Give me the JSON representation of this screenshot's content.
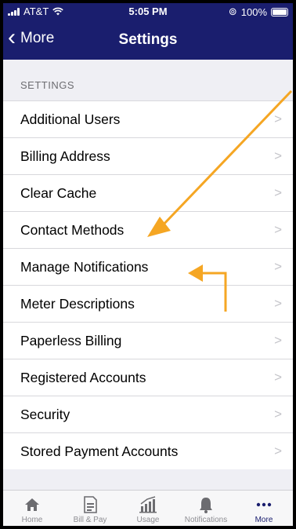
{
  "status_bar": {
    "carrier": "AT&T",
    "time": "5:05 PM",
    "battery": "100%"
  },
  "nav": {
    "back_label": "More",
    "title": "Settings"
  },
  "section": {
    "title": "SETTINGS"
  },
  "settings_items": [
    {
      "label": "Additional Users"
    },
    {
      "label": "Billing Address"
    },
    {
      "label": "Clear Cache"
    },
    {
      "label": "Contact Methods"
    },
    {
      "label": "Manage Notifications"
    },
    {
      "label": "Meter Descriptions"
    },
    {
      "label": "Paperless Billing"
    },
    {
      "label": "Registered Accounts"
    },
    {
      "label": "Security"
    },
    {
      "label": "Stored Payment Accounts"
    }
  ],
  "tabs": [
    {
      "label": "Home",
      "icon": "home-icon"
    },
    {
      "label": "Bill & Pay",
      "icon": "bill-icon"
    },
    {
      "label": "Usage",
      "icon": "usage-icon"
    },
    {
      "label": "Notifications",
      "icon": "bell-icon"
    },
    {
      "label": "More",
      "icon": "more-icon",
      "active": true
    }
  ],
  "colors": {
    "header": "#1a1e6e",
    "annotation_arrow": "#f5a623",
    "tab_inactive": "#8e8e93",
    "tab_active": "#1a1e6e"
  }
}
